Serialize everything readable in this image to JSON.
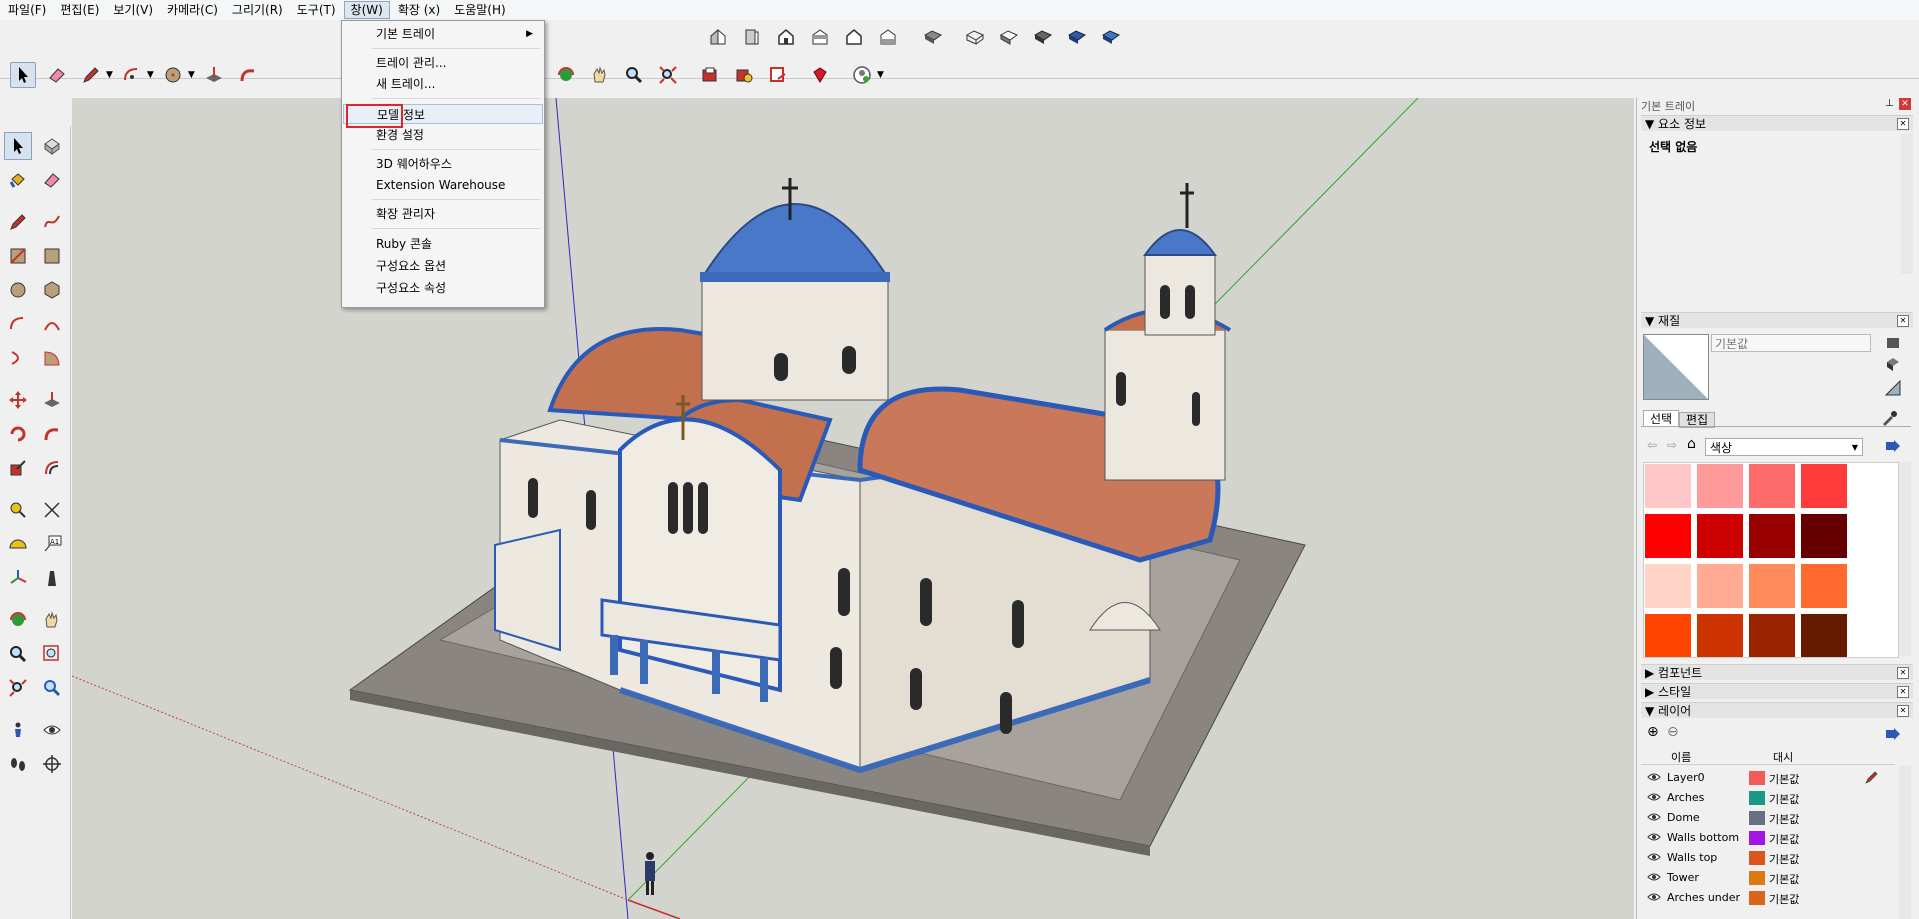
{
  "menubar": {
    "items": [
      "파일(F)",
      "편집(E)",
      "보기(V)",
      "카메라(C)",
      "그리기(R)",
      "도구(T)",
      "창(W)",
      "확장 (x)",
      "도움말(H)"
    ],
    "active_index": 6
  },
  "window_menu": {
    "items": [
      {
        "label": "기본 트레이",
        "submenu": true
      },
      {
        "label": "트레이 관리..."
      },
      {
        "label": "새 트레이..."
      },
      {
        "label": "모델 정보",
        "highlighted": true
      },
      {
        "label": "환경 설정"
      },
      {
        "label": "3D 웨어하우스"
      },
      {
        "label": "Extension Warehouse"
      },
      {
        "label": "확장 관리자"
      },
      {
        "label": "Ruby 콘솔"
      },
      {
        "label": "구성요소 옵션"
      },
      {
        "label": "구성요소 속성"
      }
    ]
  },
  "tray": {
    "title": "기본 트레이",
    "entity_info": {
      "header": "요소 정보",
      "selection": "선택 없음"
    },
    "materials": {
      "header": "재질",
      "material_name": "기본값",
      "tabs": [
        "선택",
        "편집"
      ],
      "collection": "색상",
      "swatch_colors": [
        "#ffc7c7",
        "#ff9a9a",
        "#ff6a6a",
        "#ff3a3a",
        "#ff0000",
        "#cc0000",
        "#990000",
        "#660000",
        "#ffd3c6",
        "#ffab94",
        "#ff8a5c",
        "#ff6a30",
        "#ff4400",
        "#cc3300",
        "#992200",
        "#661a00"
      ]
    },
    "collapsed_panels": [
      "컴포넌트",
      "스타일"
    ],
    "layers": {
      "header": "레이어",
      "col_name": "이름",
      "col_dash": "대시",
      "rows": [
        {
          "name": "Layer0",
          "color": "#f35a5a",
          "dash": "기본값"
        },
        {
          "name": "Arches",
          "color": "#1a9a86",
          "dash": "기본값"
        },
        {
          "name": "Dome",
          "color": "#6b6f86",
          "dash": "기본값"
        },
        {
          "name": "Walls bottom",
          "color": "#a315e0",
          "dash": "기본값"
        },
        {
          "name": "Walls top",
          "color": "#d9571c",
          "dash": "기본값"
        },
        {
          "name": "Tower",
          "color": "#d97a14",
          "dash": "기본값"
        },
        {
          "name": "Arches under",
          "color": "#d9641c",
          "dash": "기본값"
        }
      ]
    }
  }
}
